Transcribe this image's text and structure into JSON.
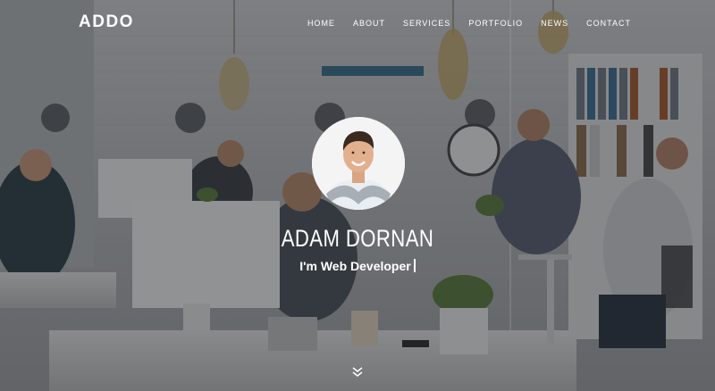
{
  "brand": {
    "logo_text": "ADDO"
  },
  "nav": {
    "items": [
      {
        "label": "HOME"
      },
      {
        "label": "ABOUT"
      },
      {
        "label": "SERVICES"
      },
      {
        "label": "PORTFOLIO"
      },
      {
        "label": "NEWS"
      },
      {
        "label": "CONTACT"
      }
    ]
  },
  "hero": {
    "name": "ADAM DORNAN",
    "tagline_prefix": "I'm",
    "tagline_role": "Web Developer",
    "avatar_icon": "profile-photo",
    "scroll_icon": "double-chevron-down-icon"
  },
  "colors": {
    "text": "#ffffff",
    "overlay": "#191b1e",
    "avatar_ring": "#ffffff"
  }
}
